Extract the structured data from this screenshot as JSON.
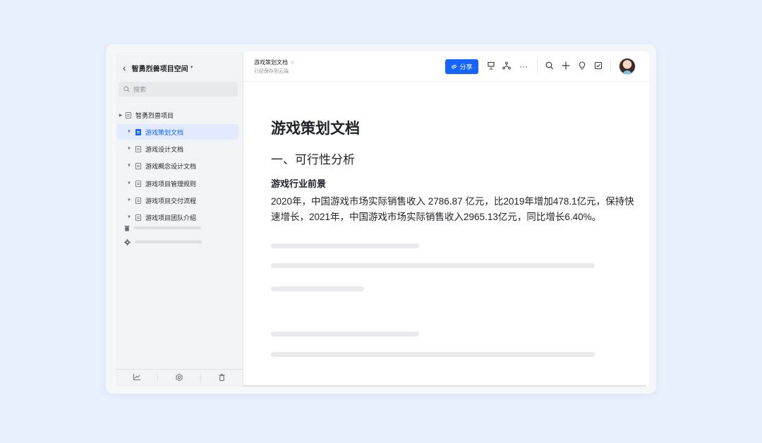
{
  "sidebar": {
    "workspace_title": "智勇烈兽项目空间",
    "search_placeholder": "搜索",
    "tree": [
      {
        "label": "智勇烈兽项目",
        "level": 0,
        "active": false
      },
      {
        "label": "游戏策划文档",
        "level": 1,
        "active": true
      },
      {
        "label": "游戏设计文档",
        "level": 1,
        "active": false
      },
      {
        "label": "游戏概念设计文档",
        "level": 1,
        "active": false
      },
      {
        "label": "游戏项目管理规则",
        "level": 1,
        "active": false
      },
      {
        "label": "游戏项目交付流程",
        "level": 1,
        "active": false
      },
      {
        "label": "游戏项目团队介绍",
        "level": 1,
        "active": false
      }
    ],
    "footer_icons": [
      "chart-icon",
      "settings-icon",
      "trash-icon"
    ]
  },
  "topbar": {
    "doc_title": "游戏策划文档",
    "saved_status": "已经保存到云端",
    "share_label": "分享",
    "icons": [
      "presentation-icon",
      "share-tree-icon",
      "more-icon",
      "search-icon",
      "add-icon",
      "bulb-icon",
      "task-icon"
    ]
  },
  "document": {
    "title": "游戏策划文档",
    "section_heading": "一、可行性分析",
    "subheading": "游戏行业前景",
    "paragraph": "2020年，中国游戏市场实际销售收入 2786.87 亿元，比2019年增加478.1亿元，保持快速增长，2021年，中国游戏市场实际销售收入2965.13亿元，同比增长6.40%。"
  },
  "colors": {
    "accent": "#1664ff",
    "background": "#e8f1fd"
  }
}
